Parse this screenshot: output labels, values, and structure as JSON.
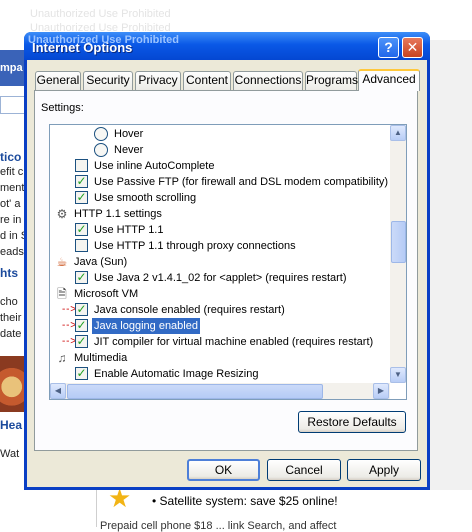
{
  "background": {
    "ghost_line1": "Unauthorized Use Prohibited",
    "ghost_line2": "Unauthorized Use Prohibited",
    "left_fragments": [
      "mpa",
      "tico",
      "efit c",
      "ment",
      "ot' a",
      "re in",
      "d in S",
      "eads",
      "hts",
      "cho",
      "their",
      "date",
      "Hea",
      "Wat"
    ],
    "satellite": "• Satellite system: save $25 online!",
    "bottom_partial": "Prepaid cell phone $18 ... link Search, and affect"
  },
  "window": {
    "title": "Internet Options",
    "title_ghost": "Unauthorized Use Prohibited",
    "help_glyph": "?",
    "close_glyph": "✕",
    "tabs": [
      "General",
      "Security",
      "Privacy",
      "Content",
      "Connections",
      "Programs",
      "Advanced"
    ],
    "active_tab": "Advanced",
    "settings_label": "Settings:",
    "tree": [
      {
        "kind": "radio",
        "label": "Hover"
      },
      {
        "kind": "radio",
        "label": "Never"
      },
      {
        "kind": "checkbox",
        "label": "Use inline AutoComplete",
        "checked": false
      },
      {
        "kind": "checkbox",
        "label": "Use Passive FTP (for firewall and DSL modem compatibility)",
        "checked": true
      },
      {
        "kind": "checkbox",
        "label": "Use smooth scrolling",
        "checked": true
      },
      {
        "kind": "group",
        "label": "HTTP 1.1 settings",
        "icon": "gears-icon"
      },
      {
        "kind": "checkbox",
        "label": "Use HTTP 1.1",
        "checked": true
      },
      {
        "kind": "checkbox",
        "label": "Use HTTP 1.1 through proxy connections",
        "checked": false
      },
      {
        "kind": "group",
        "label": "Java (Sun)",
        "icon": "java-icon"
      },
      {
        "kind": "checkbox",
        "label": "Use Java 2 v1.4.1_02 for <applet> (requires restart)",
        "checked": true
      },
      {
        "kind": "group",
        "label": "Microsoft VM",
        "icon": "document-icon"
      },
      {
        "kind": "checkbox",
        "label": "Java console enabled (requires restart)",
        "checked": true,
        "arrow": true
      },
      {
        "kind": "checkbox",
        "label": "Java logging enabled",
        "checked": true,
        "arrow": true,
        "selected": true
      },
      {
        "kind": "checkbox",
        "label": "JIT compiler for virtual machine enabled (requires restart)",
        "checked": true,
        "arrow": true
      },
      {
        "kind": "group",
        "label": "Multimedia",
        "icon": "multimedia-icon"
      },
      {
        "kind": "checkbox",
        "label": "Enable Automatic Image Resizing",
        "checked": true
      }
    ],
    "restore_defaults": "Restore Defaults",
    "ok": "OK",
    "cancel": "Cancel",
    "apply": "Apply"
  }
}
